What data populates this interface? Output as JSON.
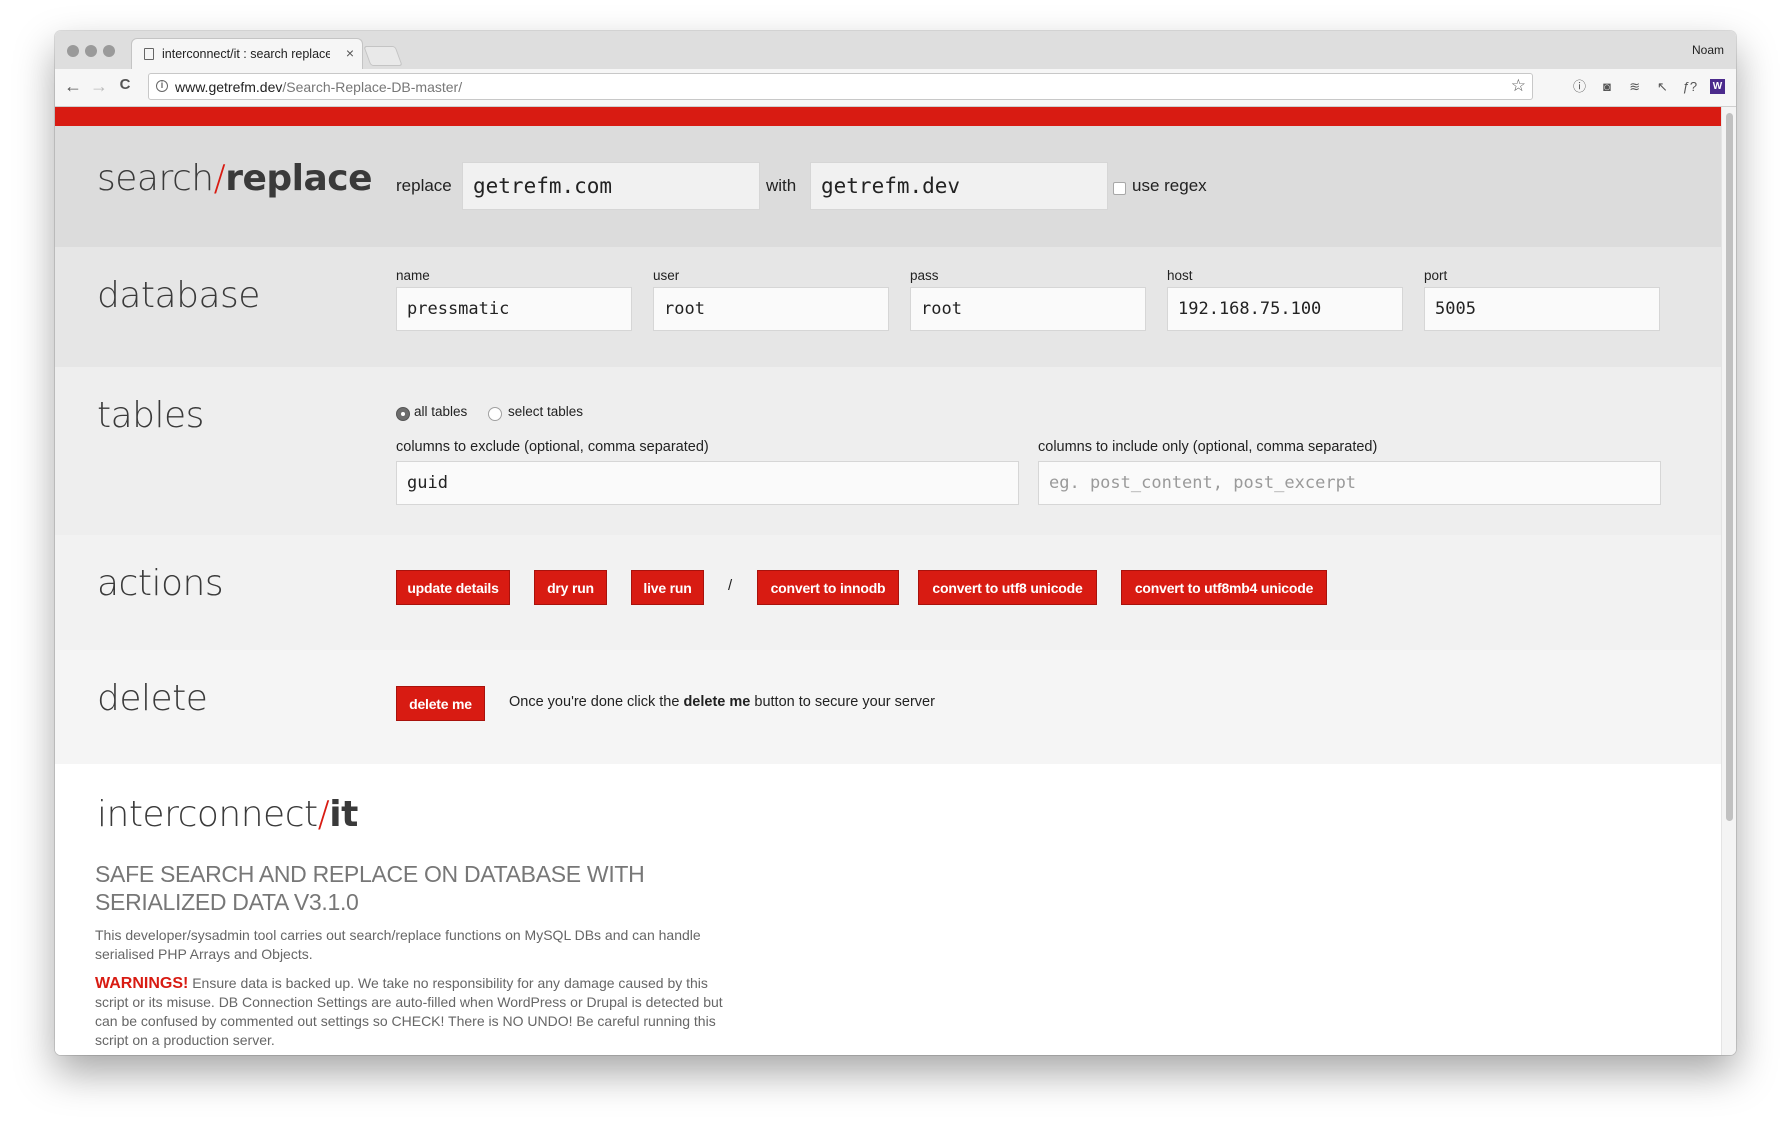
{
  "browser": {
    "tab_title": "interconnect/it : search replace",
    "tab_close": "×",
    "profile_name": "Noam",
    "url_domain": "www.getrefm.dev",
    "url_path": "/Search-Replace-DB-master/",
    "back": "←",
    "forward": "→",
    "reload": "C",
    "bookmark": "☆",
    "extensions": [
      "info-icon",
      "camera-icon",
      "layers-icon",
      "pointer-icon",
      "formula-icon",
      "w-icon",
      "bug-icon",
      "bird-icon",
      "chat-icon",
      "eye-off-icon",
      "green-dot-icon",
      "upload-icon",
      "menu-icon"
    ],
    "extension_glyphs": [
      "ⓘ",
      "◙",
      "≋",
      "↖",
      "ƒ?",
      "W",
      "✱",
      "✈",
      "▣",
      "⌀",
      "●",
      "⊙",
      "⋮"
    ]
  },
  "colors": {
    "accent": "#d81b12",
    "section_dark": "#dcdcdc",
    "section_mid": "#e6e6e6",
    "section_light": "#eeeeee",
    "section_lighter": "#f4f4f4"
  },
  "search": {
    "heading_1": "search",
    "heading_slash": "/",
    "heading_2": "replace",
    "replace_label": "replace",
    "replace_value": "getrefm.com",
    "with_label": "with",
    "with_value": "getrefm.dev",
    "regex_label": "use regex"
  },
  "database": {
    "heading": "database",
    "fields": [
      {
        "label": "name",
        "value": "pressmatic"
      },
      {
        "label": "user",
        "value": "root"
      },
      {
        "label": "pass",
        "value": "root"
      },
      {
        "label": "host",
        "value": "192.168.75.100"
      },
      {
        "label": "port",
        "value": "5005"
      }
    ]
  },
  "tables": {
    "heading": "tables",
    "radio_all": "all tables",
    "radio_select": "select tables",
    "exclude_label": "columns to exclude (optional, comma separated)",
    "exclude_value": "guid",
    "include_label": "columns to include only (optional, comma separated)",
    "include_placeholder": "eg. post_content, post_excerpt"
  },
  "actions": {
    "heading": "actions",
    "update": "update details",
    "dry_run": "dry run",
    "live_run": "live run",
    "separator": "/",
    "innodb": "convert to innodb",
    "utf8": "convert to utf8 unicode",
    "utf8mb4": "convert to utf8mb4 unicode"
  },
  "delete": {
    "heading": "delete",
    "button": "delete me",
    "text_before": "Once you're done click the ",
    "text_bold": "delete me",
    "text_after": " button to secure your server"
  },
  "about": {
    "brand_1": "interconnect",
    "brand_slash": "/",
    "brand_2": "it",
    "tagline_1": "SAFE SEARCH AND REPLACE ON DATABASE WITH",
    "tagline_2": "SERIALIZED DATA V3.1.0",
    "description": "This developer/sysadmin tool carries out search/replace functions on MySQL DBs and can handle serialised PHP Arrays and Objects.",
    "warning_label": "WARNINGS!",
    "warning_text": " Ensure data is backed up. We take no responsibility for any damage caused by this script or its misuse. DB Connection Settings are auto-filled when WordPress or Drupal is detected but can be confused by commented out settings so CHECK! There is NO UNDO! Be careful running this script on a production server."
  }
}
